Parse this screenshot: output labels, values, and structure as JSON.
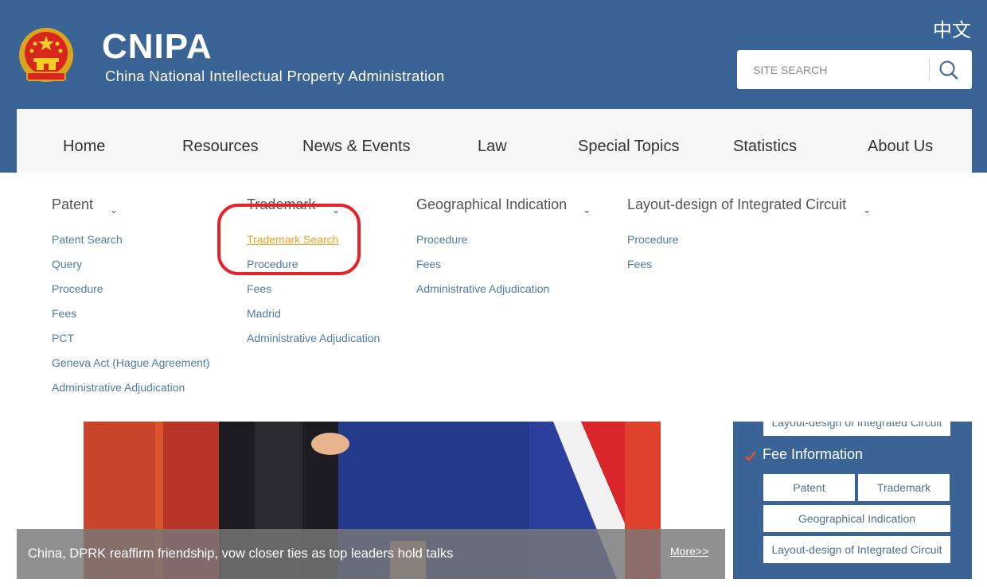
{
  "header": {
    "site_name": "CNIPA",
    "site_full_name": "China National Intellectual Property Administration",
    "language_link": "中文",
    "search": {
      "placeholder": "SITE SEARCH",
      "icon": "search-icon"
    }
  },
  "nav": {
    "items": [
      {
        "label": "Home"
      },
      {
        "label": "Resources"
      },
      {
        "label": "News & Events"
      },
      {
        "label": "Law"
      },
      {
        "label": "Special Topics"
      },
      {
        "label": "Statistics"
      },
      {
        "label": "About Us"
      }
    ]
  },
  "dropdown": {
    "columns": [
      {
        "heading": "Patent",
        "links": [
          "Patent Search",
          "Query",
          "Procedure",
          "Fees",
          "PCT",
          "Geneva Act (Hague Agreement)",
          "Administrative Adjudication"
        ]
      },
      {
        "heading": "Trademark",
        "links": [
          "Trademark Search",
          "Procedure",
          "Fees",
          "Madrid",
          "Administrative Adjudication"
        ],
        "active_link": "Trademark Search"
      },
      {
        "heading": "Geographical Indication",
        "links": [
          "Procedure",
          "Fees",
          "Administrative Adjudication"
        ]
      },
      {
        "heading": "Layout-design of Integrated Circuit",
        "links": [
          "Procedure",
          "Fees"
        ]
      }
    ],
    "caret_glyph": "⌄"
  },
  "banner": {
    "caption": "China, DPRK reaffirm friendship, vow closer ties as top leaders hold talks",
    "more_label": "More>>"
  },
  "sidebar": {
    "partial_button": "Layout-design of Integrated Circuit",
    "title": "Fee Information",
    "buttons": [
      "Patent",
      "Trademark",
      "Geographical Indication",
      "Layout-design of Integrated Circuit"
    ]
  },
  "colors": {
    "header_blue": "#3a6496",
    "link_blue": "#4f7ba6",
    "active_orange": "#f0a020",
    "annotation_red": "#e3242b"
  }
}
